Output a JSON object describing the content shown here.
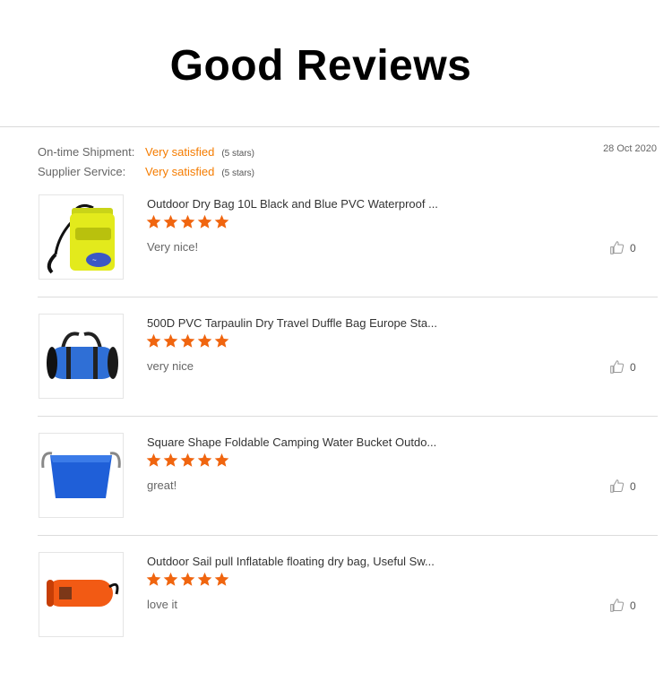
{
  "heading": "Good Reviews",
  "ratings": {
    "shipment": {
      "label": "On-time Shipment:",
      "value": "Very satisfied",
      "note": "(5 stars)"
    },
    "service": {
      "label": "Supplier Service:",
      "value": "Very satisfied",
      "note": "(5 stars)"
    },
    "date": "28 Oct 2020"
  },
  "colors": {
    "accent": "#f57c00",
    "star": "#f0650f"
  },
  "reviews": [
    {
      "product": "Outdoor Dry Bag 10L Black and Blue PVC Waterproof ...",
      "stars": 5,
      "comment": "Very nice!",
      "likes": "0",
      "image": "yellow-dry-bag"
    },
    {
      "product": "500D PVC Tarpaulin Dry Travel Duffle Bag Europe Sta...",
      "stars": 5,
      "comment": "very nice",
      "likes": "0",
      "image": "blue-duffle-bag"
    },
    {
      "product": "Square Shape Foldable Camping Water Bucket Outdo...",
      "stars": 5,
      "comment": "great!",
      "likes": "0",
      "image": "blue-water-bucket"
    },
    {
      "product": "Outdoor Sail pull Inflatable floating dry bag, Useful Sw...",
      "stars": 5,
      "comment": "love it",
      "likes": "0",
      "image": "orange-float-bag"
    }
  ]
}
